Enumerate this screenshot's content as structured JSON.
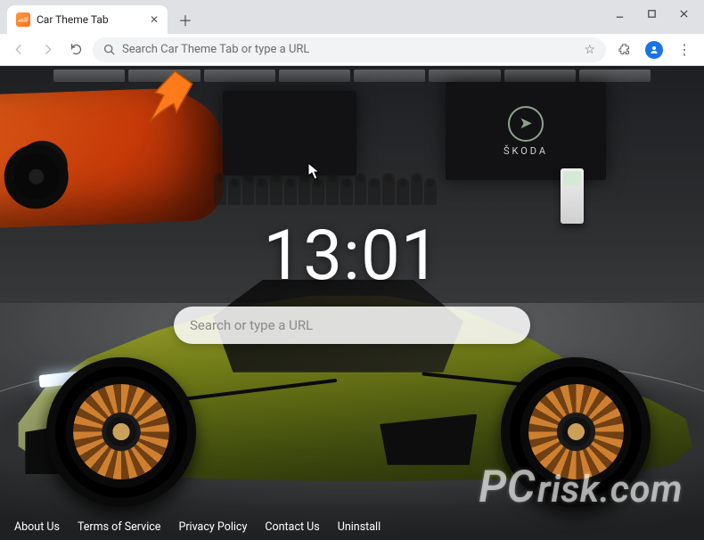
{
  "window": {
    "tab_title": "Car Theme Tab",
    "favicon_glyph": "🏎"
  },
  "toolbar": {
    "omnibox_placeholder": "Search Car Theme Tab or type a URL"
  },
  "newtab": {
    "clock": "13:01",
    "search_placeholder": "Search or type a URL"
  },
  "backdrop": {
    "brand_logo_glyph": "➤",
    "brand_name": "ŠKODA"
  },
  "footer": {
    "links": [
      "About Us",
      "Terms of Service",
      "Privacy Policy",
      "Contact Us",
      "Uninstall"
    ]
  },
  "watermark": {
    "prefix": "PC",
    "suffix": "risk.com"
  },
  "colors": {
    "arrow": "#ff7a1a",
    "car_body": "#8e9a22",
    "wheel_accent": "#c47a2e",
    "profile": "#1a73e8"
  }
}
